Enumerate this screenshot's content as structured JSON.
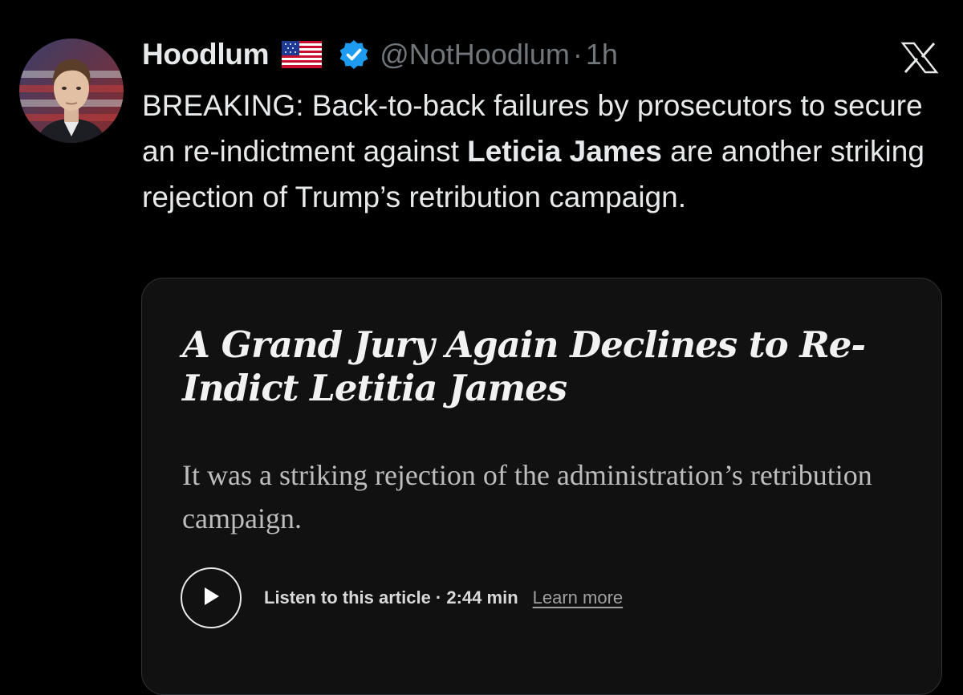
{
  "tweet": {
    "display_name": "Hoodlum",
    "flag_emoji_icon": "us-flag-icon",
    "verified_icon": "verified-badge-icon",
    "handle": "@NotHoodlum",
    "separator": "·",
    "timestamp": "1h",
    "text_before_bold": "BREAKING: Back-to-back failures by prosecutors to secure an re-indictment against ",
    "text_bold": "Leticia James",
    "text_after_bold": " are another striking rejection of Trump’s retribution campaign."
  },
  "platform": {
    "logo_icon": "x-logo-icon"
  },
  "article_card": {
    "headline": "A Grand Jury Again Declines to Re-Indict Letitia James",
    "summary": "It was a striking rejection of the administration’s retribution campaign.",
    "play_icon": "play-icon",
    "listen_label": "Listen to this article · 2:44 min",
    "learn_more": "Learn more"
  },
  "colors": {
    "background": "#000000",
    "text_primary": "#e7e9ea",
    "text_secondary": "#71767b",
    "verified_blue": "#1d9bf0",
    "card_background": "#111111",
    "card_border": "#2f3336"
  }
}
